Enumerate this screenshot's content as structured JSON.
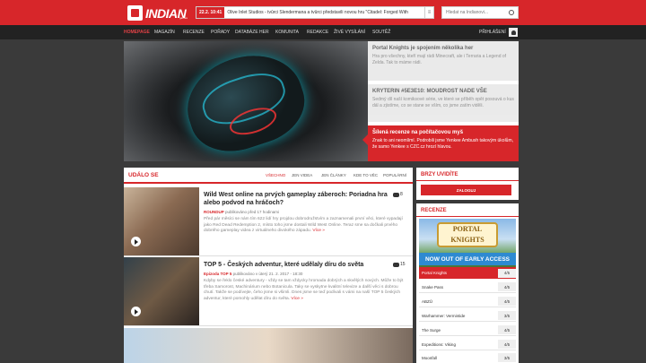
{
  "header": {
    "logo_text": "INDIAN",
    "logo_sub": "games",
    "ticker_date": "22.2. 10:41",
    "ticker_text": "Olive Inlet Studios - tvůrci Slendermana a tvůrci představili novou hru \"Citadel: Forged With",
    "ticker_btn": "≡",
    "search_placeholder": "Hledat na Indianovi..."
  },
  "nav": {
    "items": [
      "Homepage",
      "Magazín",
      "Recenze",
      "Pořady",
      "Databáze her",
      "Komunita",
      "Redakce",
      "Živé vysílání",
      "Soutěž"
    ],
    "login": "PŘIHLÁŠENÍ"
  },
  "hero": {
    "items": [
      {
        "title": "Portal Knights je spojením několika her",
        "desc": "Hra pro všechny, kteří mají rádi Minecraft, ale i Terraria a Legend of Zelda. Tak to máme rádi."
      },
      {
        "title": "KRYTERIN #5E3E10: MOUDROST NADE VŠE",
        "desc": "Sedmý díl naší komiksové série, ve které se příběh opět posouvá o kus dál a zjistíme, co se stane se vším, co jsme zatím viděli."
      },
      {
        "title": "Šílená recenze na počítačovou myš",
        "desc": "Znak to ani neomlímí. Podrobili jsme Yenkee Ambush takovým úkolům, že samo Yenkee s CZC.cz hrozí hlavou."
      }
    ]
  },
  "feed": {
    "title": "UDÁLO SE",
    "filters": [
      "Všechno",
      "Jen videa",
      "Jen články",
      "Kde to věc",
      "Populární"
    ],
    "articles": [
      {
        "title": "Wild West online na prvých gameplay záberoch: Poriadna hra alebo podvod na hráčoch?",
        "comments": "8",
        "meta_cat": "ROUNDUP",
        "meta_rest": " publikováno před 17 hodinami",
        "excerpt": "Před pár měsíci se nám tím 622 lidí hry projdou dobrodružstvím a zaznamenali první věci, které vypadají jako Red Dead Redemption 2, místo toho jsme dostali Wild West Online. Teraz sme sa dočkali prvého dobrého gameplay videa z virtuálneho divokého západu.",
        "more": "Více »"
      },
      {
        "title": "TOP 5 - Českých adventur, které udělaly díru do světa",
        "comments": "15",
        "meta_cat": "Epizoda TOP 5",
        "meta_rest": " publikováno v úterý 21. 2. 2017 - 18:30",
        "excerpt": "Kdyby se řeklo české adventury - vždy se tam vždycky hromada dobrých a skvělých nových. Může to být třeba Samorost, Machinárium nebo Botanicula. Taky se vyskytne kvalitní televize a další věci s dobrou chutí. Takže se podívejte, čeho jsme si všimli. Dnes jsme se teď podívali s vámi na naší TOP 5 českých adventur, které pomohly udělat díru do světa.",
        "more": "Více »"
      }
    ]
  },
  "sidebar": {
    "login_title": "BRZY UVIDÍTE",
    "login_btn": "ZALOGUJ",
    "reviews_title": "RECENZE",
    "banner_title": "PORTAL KNIGHTS",
    "banner_cta": "NOW OUT OF EARLY ACCESS",
    "reviews": [
      {
        "name": "Portal Knights",
        "score": "4/5"
      },
      {
        "name": "Snake Pass",
        "score": "4/5"
      },
      {
        "name": "ABZÛ",
        "score": "4/5"
      },
      {
        "name": "Warhammer: Vermintide",
        "score": "3/5"
      },
      {
        "name": "The Surge",
        "score": "4/5"
      },
      {
        "name": "Expeditions: Viking",
        "score": "4/5"
      },
      {
        "name": "Moonfall",
        "score": "3/5"
      }
    ]
  },
  "colors": {
    "accent": "#d7262a",
    "nav_bg": "#222222",
    "page_bg": "#3a3a3a"
  }
}
